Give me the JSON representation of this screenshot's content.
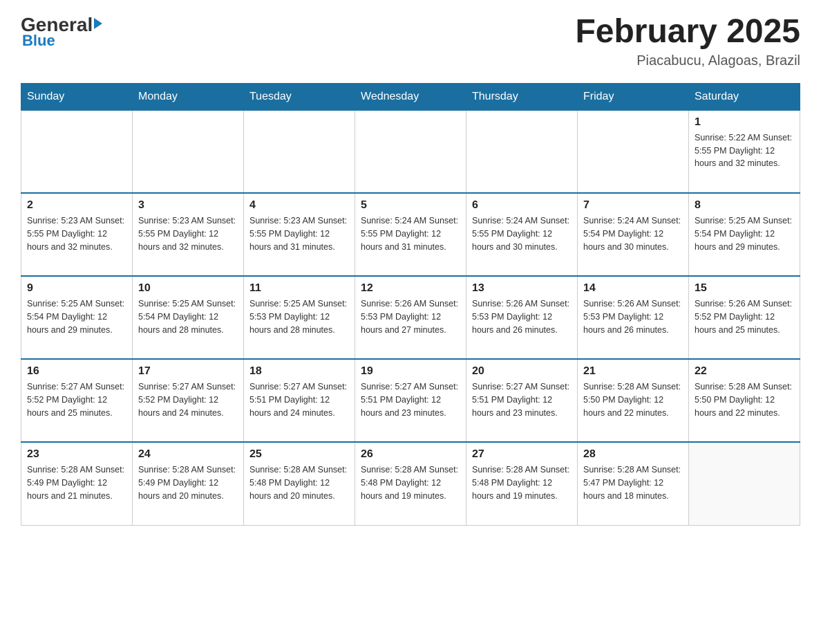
{
  "header": {
    "logo_general": "General",
    "logo_blue": "Blue",
    "month_title": "February 2025",
    "location": "Piacabucu, Alagoas, Brazil"
  },
  "weekdays": [
    "Sunday",
    "Monday",
    "Tuesday",
    "Wednesday",
    "Thursday",
    "Friday",
    "Saturday"
  ],
  "weeks": [
    [
      {
        "day": "",
        "info": ""
      },
      {
        "day": "",
        "info": ""
      },
      {
        "day": "",
        "info": ""
      },
      {
        "day": "",
        "info": ""
      },
      {
        "day": "",
        "info": ""
      },
      {
        "day": "",
        "info": ""
      },
      {
        "day": "1",
        "info": "Sunrise: 5:22 AM\nSunset: 5:55 PM\nDaylight: 12 hours and 32 minutes."
      }
    ],
    [
      {
        "day": "2",
        "info": "Sunrise: 5:23 AM\nSunset: 5:55 PM\nDaylight: 12 hours and 32 minutes."
      },
      {
        "day": "3",
        "info": "Sunrise: 5:23 AM\nSunset: 5:55 PM\nDaylight: 12 hours and 32 minutes."
      },
      {
        "day": "4",
        "info": "Sunrise: 5:23 AM\nSunset: 5:55 PM\nDaylight: 12 hours and 31 minutes."
      },
      {
        "day": "5",
        "info": "Sunrise: 5:24 AM\nSunset: 5:55 PM\nDaylight: 12 hours and 31 minutes."
      },
      {
        "day": "6",
        "info": "Sunrise: 5:24 AM\nSunset: 5:55 PM\nDaylight: 12 hours and 30 minutes."
      },
      {
        "day": "7",
        "info": "Sunrise: 5:24 AM\nSunset: 5:54 PM\nDaylight: 12 hours and 30 minutes."
      },
      {
        "day": "8",
        "info": "Sunrise: 5:25 AM\nSunset: 5:54 PM\nDaylight: 12 hours and 29 minutes."
      }
    ],
    [
      {
        "day": "9",
        "info": "Sunrise: 5:25 AM\nSunset: 5:54 PM\nDaylight: 12 hours and 29 minutes."
      },
      {
        "day": "10",
        "info": "Sunrise: 5:25 AM\nSunset: 5:54 PM\nDaylight: 12 hours and 28 minutes."
      },
      {
        "day": "11",
        "info": "Sunrise: 5:25 AM\nSunset: 5:53 PM\nDaylight: 12 hours and 28 minutes."
      },
      {
        "day": "12",
        "info": "Sunrise: 5:26 AM\nSunset: 5:53 PM\nDaylight: 12 hours and 27 minutes."
      },
      {
        "day": "13",
        "info": "Sunrise: 5:26 AM\nSunset: 5:53 PM\nDaylight: 12 hours and 26 minutes."
      },
      {
        "day": "14",
        "info": "Sunrise: 5:26 AM\nSunset: 5:53 PM\nDaylight: 12 hours and 26 minutes."
      },
      {
        "day": "15",
        "info": "Sunrise: 5:26 AM\nSunset: 5:52 PM\nDaylight: 12 hours and 25 minutes."
      }
    ],
    [
      {
        "day": "16",
        "info": "Sunrise: 5:27 AM\nSunset: 5:52 PM\nDaylight: 12 hours and 25 minutes."
      },
      {
        "day": "17",
        "info": "Sunrise: 5:27 AM\nSunset: 5:52 PM\nDaylight: 12 hours and 24 minutes."
      },
      {
        "day": "18",
        "info": "Sunrise: 5:27 AM\nSunset: 5:51 PM\nDaylight: 12 hours and 24 minutes."
      },
      {
        "day": "19",
        "info": "Sunrise: 5:27 AM\nSunset: 5:51 PM\nDaylight: 12 hours and 23 minutes."
      },
      {
        "day": "20",
        "info": "Sunrise: 5:27 AM\nSunset: 5:51 PM\nDaylight: 12 hours and 23 minutes."
      },
      {
        "day": "21",
        "info": "Sunrise: 5:28 AM\nSunset: 5:50 PM\nDaylight: 12 hours and 22 minutes."
      },
      {
        "day": "22",
        "info": "Sunrise: 5:28 AM\nSunset: 5:50 PM\nDaylight: 12 hours and 22 minutes."
      }
    ],
    [
      {
        "day": "23",
        "info": "Sunrise: 5:28 AM\nSunset: 5:49 PM\nDaylight: 12 hours and 21 minutes."
      },
      {
        "day": "24",
        "info": "Sunrise: 5:28 AM\nSunset: 5:49 PM\nDaylight: 12 hours and 20 minutes."
      },
      {
        "day": "25",
        "info": "Sunrise: 5:28 AM\nSunset: 5:48 PM\nDaylight: 12 hours and 20 minutes."
      },
      {
        "day": "26",
        "info": "Sunrise: 5:28 AM\nSunset: 5:48 PM\nDaylight: 12 hours and 19 minutes."
      },
      {
        "day": "27",
        "info": "Sunrise: 5:28 AM\nSunset: 5:48 PM\nDaylight: 12 hours and 19 minutes."
      },
      {
        "day": "28",
        "info": "Sunrise: 5:28 AM\nSunset: 5:47 PM\nDaylight: 12 hours and 18 minutes."
      },
      {
        "day": "",
        "info": ""
      }
    ]
  ],
  "colors": {
    "header_bg": "#1a6fa0",
    "header_text": "#ffffff",
    "border": "#cccccc",
    "accent": "#1a7abf"
  }
}
